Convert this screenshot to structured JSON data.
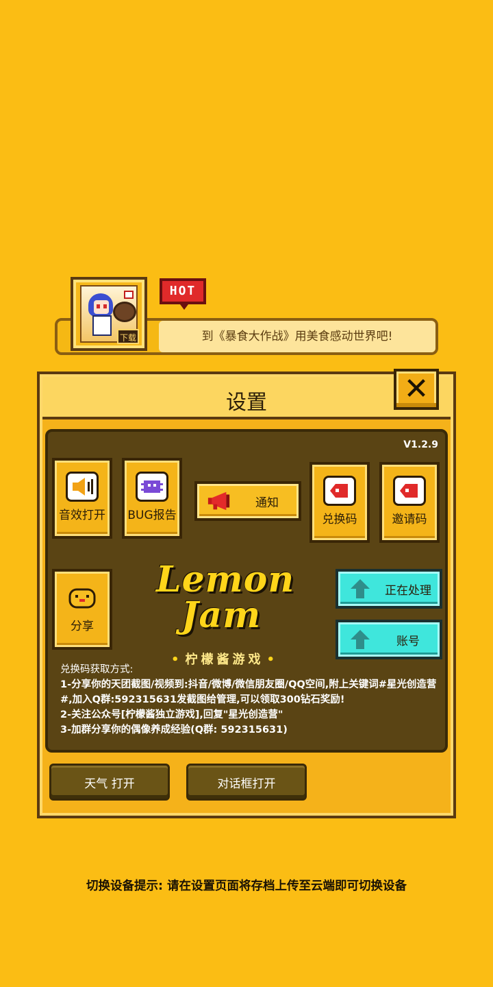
{
  "promo": {
    "hot_label": "HOT",
    "download_label": "下载",
    "text": "到《暴食大作战》用美食感动世界吧!"
  },
  "settings": {
    "title": "设置",
    "close_icon": "close-icon",
    "version": "V1.2.9",
    "buttons": {
      "sound": "音效打开",
      "bug_report": "BUG报告",
      "notice": "通知",
      "redeem_code": "兑换码",
      "invite_code": "邀请码",
      "share": "分享",
      "processing": "正在处理",
      "account": "账号"
    },
    "logo": {
      "line1": "Lemon",
      "line2": "Jam",
      "subtitle": "柠檬酱游戏"
    },
    "info": {
      "title": "兑换码获取方式:",
      "line1": "1-分享你的天团截图/视频到:抖音/微博/微信朋友圈/QQ空间,附上关键词#星光创造营#,加入Q群:592315631发截图给管理,可以领取300钻石奖励!",
      "line2": "2-关注公众号[柠檬酱独立游戏],回复\"星光创造营\"",
      "line3": "3-加群分享你的偶像养成经验(Q群: 592315631)"
    },
    "bottom": {
      "weather": "天气 打开",
      "dialog": "对话框打开"
    }
  },
  "tip": "切换设备提示: 请在设置页面将存档上传至云端即可切换设备",
  "colors": {
    "background": "#fbbd14",
    "panel": "#f5b21a",
    "inner_panel": "#5a4414",
    "teal_button": "#3fe6dc",
    "hot_red": "#e02a2a"
  }
}
